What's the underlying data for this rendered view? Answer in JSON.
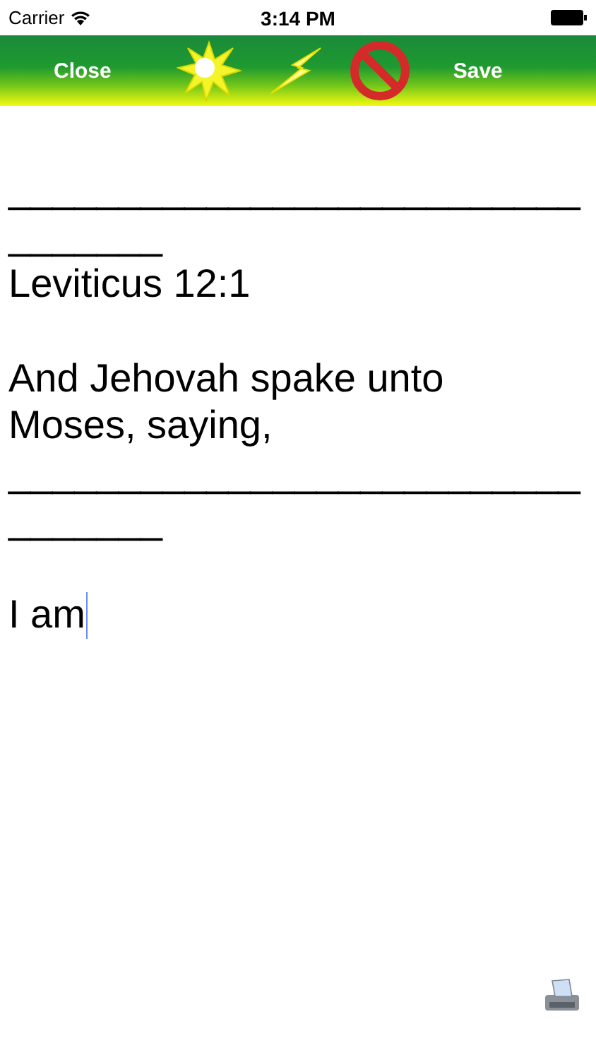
{
  "status_bar": {
    "carrier": "Carrier",
    "time": "3:14 PM"
  },
  "toolbar": {
    "close": "Close",
    "save": "Save"
  },
  "editor": {
    "paragraphs": [
      [
        "__________________________",
        "_______",
        "Leviticus 12:1"
      ],
      [
        "And Jehovah spake unto",
        "Moses, saying,",
        "__________________________",
        "_______"
      ],
      [
        "I am"
      ]
    ]
  }
}
